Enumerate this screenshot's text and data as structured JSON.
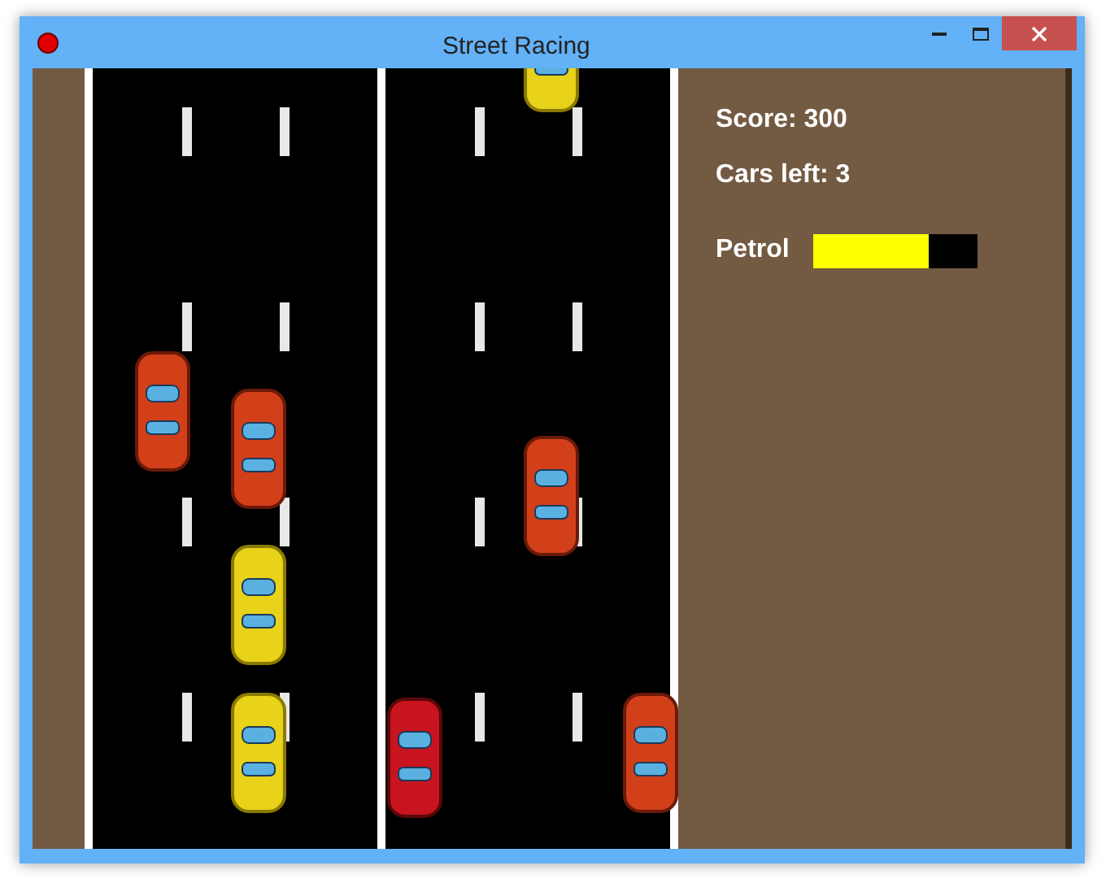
{
  "window": {
    "title": "Street Racing"
  },
  "hud": {
    "score": "Score: 300",
    "cars_left": "Cars left: 3",
    "petrol": {
      "label": "Petrol",
      "level": 0.7
    }
  }
}
